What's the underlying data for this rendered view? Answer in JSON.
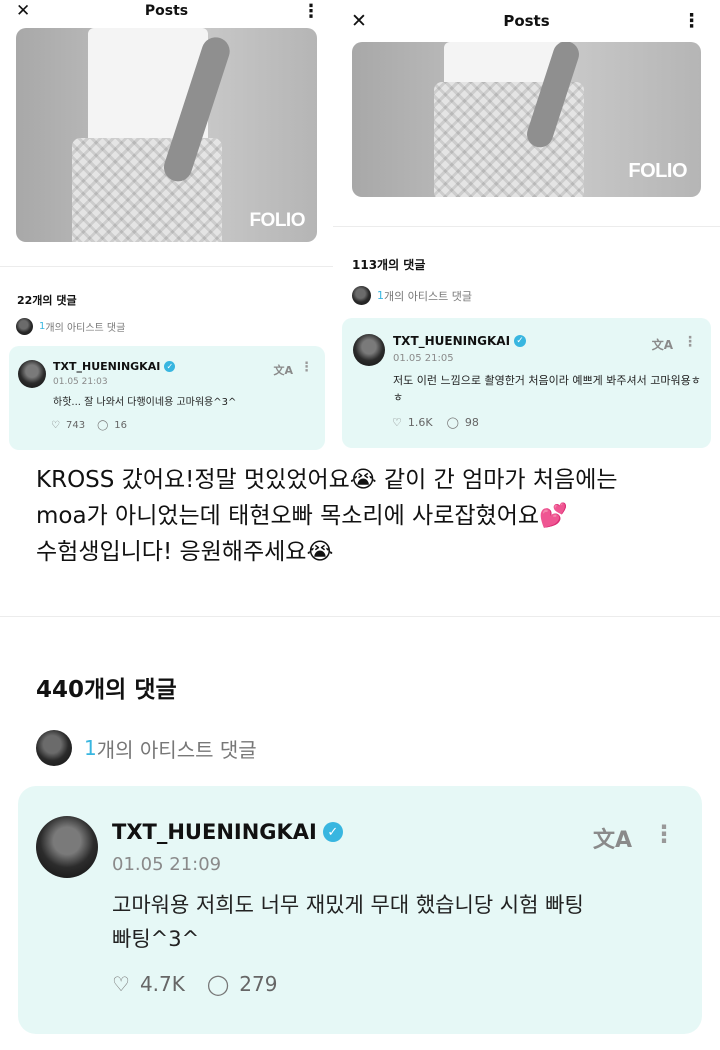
{
  "left_panel": {
    "header": {
      "close_icon": "✕",
      "title": "Posts",
      "more_icon": "⋮"
    },
    "photo": {
      "logo": "FOLIO"
    },
    "comment_count": "22개의 댓글",
    "artist_row": {
      "num": "1",
      "label": "개의 아티스트 댓글"
    },
    "card": {
      "username": "TXT_HUENINGKAI",
      "date": "01.05 21:03",
      "text": "하핫... 잘 나와서 다행이네용 고마워용^3^",
      "likes": "743",
      "replies": "16"
    }
  },
  "right_panel": {
    "header": {
      "close_icon": "✕",
      "title": "Posts",
      "more_icon": "⋮"
    },
    "photo": {
      "logo": "FOLIO"
    },
    "comment_count": "113개의 댓글",
    "artist_row": {
      "num": "1",
      "label": "개의 아티스트 댓글"
    },
    "card": {
      "username": "TXT_HUENINGKAI",
      "date": "01.05 21:05",
      "text": "저도 이런 느낌으로 촬영한거 처음이라 예쁘게 봐주셔서 고마워용ㅎㅎ",
      "likes": "1.6K",
      "replies": "98"
    }
  },
  "post_text": {
    "line1": "KROSS 갔어요!정말 멋있었어요😭 같이 간 엄마가 처음에는",
    "line2": "moa가 아니었는데 태현오빠 목소리에 사로잡혔어요💕",
    "line3": "수험생입니다! 응원해주세요😭"
  },
  "bottom_panel": {
    "comment_count": "440개의 댓글",
    "artist_row": {
      "num": "1",
      "label": "개의 아티스트 댓글"
    },
    "card": {
      "username": "TXT_HUENINGKAI",
      "date": "01.05 21:09",
      "text_line1": "고마워용 저희도 너무 재밌게 무대 했습니당 시험 빠팅",
      "text_line2": "빠팅^3^",
      "likes": "4.7K",
      "replies": "279"
    }
  },
  "icons": {
    "translate": "translate-icon",
    "kebab": "kebab-icon",
    "like": "like-icon",
    "reply": "reply-icon",
    "verified": "verified-icon"
  },
  "colors": {
    "card_bg": "#e6f8f6",
    "accent": "#38b6e0"
  }
}
